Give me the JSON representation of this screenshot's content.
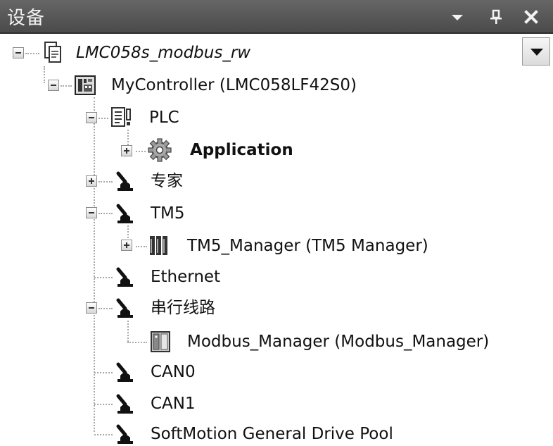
{
  "title": "设备",
  "header_icons": [
    "chevron-down-icon",
    "pin-icon",
    "close-icon"
  ],
  "tree": {
    "project": "LMC058s_modbus_rw",
    "controller": "MyController (LMC058LF42S0)",
    "plc": "PLC",
    "application": "Application",
    "expert": "专家",
    "tm5": "TM5",
    "tm5_manager": "TM5_Manager (TM5 Manager)",
    "ethernet": "Ethernet",
    "serial_line": "串行线路",
    "modbus_manager": "Modbus_Manager (Modbus_Manager)",
    "can0": "CAN0",
    "can1": "CAN1",
    "softmotion": "SoftMotion General Drive Pool"
  }
}
